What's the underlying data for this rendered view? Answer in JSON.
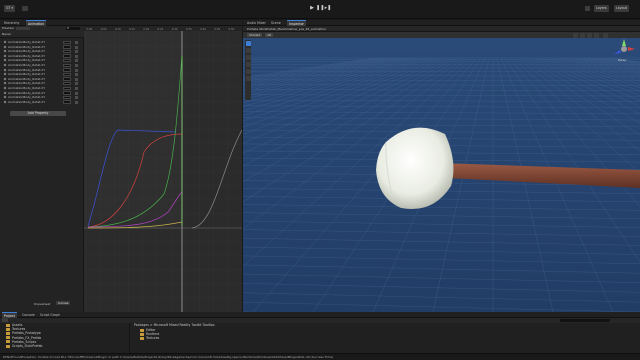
{
  "toolbar": {
    "account": "GT ▾",
    "cloud_icon": "cloud-icon",
    "layers": "Layers",
    "layout": "Layout",
    "play_icon": "play-icon",
    "pause_icon": "pause-icon",
    "step_icon": "step-icon"
  },
  "left_tabs": [
    {
      "label": "Hierarchy",
      "active": false
    },
    {
      "label": "Animation",
      "active": true
    }
  ],
  "animation": {
    "preview_label": "Preview",
    "frame_value": "0",
    "clip_name": "Naval",
    "properties": [
      "AnimationBody_Rotat.XY",
      "AnimationBody_Rotat.XY",
      "AnimationBody_Rotat.XY",
      "AnimationBody_Rotat.XY",
      "AnimationBody_Rotat.XY",
      "AnimationBody_Rotat.XY",
      "AnimationBody_Rotat.XY",
      "AnimationBody_Rotat.XY",
      "AnimationBody_Rotat.XY",
      "AnimationBody_Rotat.XY",
      "AnimationBody_Rotat.XY",
      "AnimationBody_Rotat.XY",
      "AnimationBody_Rotat.XY",
      "AnimationBody_Rotat.XY"
    ],
    "add_property": "Add Property",
    "bottom_tabs": [
      "Dopesheet",
      "Curves"
    ],
    "time_marks": [
      "0:00",
      "0:05",
      "0:10",
      "0:15",
      "0:20",
      "0:25",
      "0:30",
      "0:35",
      "0:40",
      "0:45",
      "0:50"
    ]
  },
  "curves": {
    "colors": {
      "blue": "#3b54e0",
      "red": "#d24040",
      "green": "#49b04a",
      "magenta": "#b844c8",
      "yellow": "#c8b24a",
      "lightgreen": "#7fd86c",
      "grey": "#8a8a8a"
    }
  },
  "right_tabs": [
    {
      "label": "Audio Mixer",
      "active": false
    },
    {
      "label": "Scene",
      "active": false
    },
    {
      "label": "Inspector",
      "active": true
    }
  ],
  "scene": {
    "breadcrumb": "Prefabs  StickPrefab_Marshmallow_pos_45_animation",
    "shading_mode": "Shaded",
    "gizmo_label": "Persp",
    "view_2d": "2D",
    "background_color": "#264470"
  },
  "bottom_panel": {
    "tabs": [
      "Project",
      "Console",
      "Script Graph"
    ],
    "tree": [
      "Assets",
      "Textures",
      "Prefabs_Prototype",
      "Prefabs_FX_Prefab",
      "Prefabs_Scripts",
      "Scripts_StickPrefab"
    ],
    "breadcrumb": "Packages > Microsoft Mixed Reality Toolkit Tooltips",
    "items": [
      "Editor",
      "Runtime",
      "Textures"
    ]
  },
  "status": {
    "message": "DllNotFoundException: Unable to load DLL 'MicrosoftHoloLens2Plugin' in path C:/Users/Rubble/Project/Library/PackageCache/com.microsoft.mixedreality.openxr/Runtime/Windows/x64/SharedPluginsDLL.dll (Success Time)"
  }
}
